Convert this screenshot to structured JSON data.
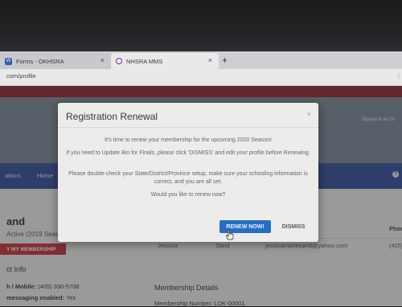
{
  "browser": {
    "tabs": [
      {
        "label": "Forms - OKHSRA",
        "close": "×"
      },
      {
        "label": "NHSRA MMS",
        "close": "×"
      }
    ],
    "new_tab": "+",
    "url": "com/profile"
  },
  "header": {
    "signed_in": "Signed in as Gr"
  },
  "nav": {
    "items": [
      "ations",
      "Horse"
    ]
  },
  "profile": {
    "name": "and",
    "status": "Active (2019 Seas",
    "membership_button": "Y MY MEMBERSHIP",
    "contact_title": "ct Info",
    "phone_label": "h / Mobile:",
    "phone_value": "(405) 330-5708",
    "messaging_label": "messaging enabled:",
    "messaging_value": "Yes"
  },
  "contacts_table": {
    "phone_header": "Phon",
    "row": {
      "first": "Jessica",
      "last": "Sand",
      "email": "jessicamariesand@yahoo.com",
      "phone": "(405)"
    }
  },
  "membership": {
    "title": "Membership Details",
    "number_label": "Membership Number:",
    "number_value": "LOK-00001"
  },
  "modal": {
    "title": "Registration Renewal",
    "close": "×",
    "line1": "It's time to renew your membership for the upcoming 2020 Season!",
    "line2": "If you need to Update Bio for Finals, please click 'DISMISS' and edit your profile before Renewing.",
    "line3": "Please double-check your State/District/Province setup, make sure your schooling information is correct, and you are all set.",
    "line4": "Would you like to renew now?",
    "renew_label": "RENEW NOW!",
    "dismiss_label": "DISMISS"
  },
  "colors": {
    "accent": "#1e6fd0",
    "nav": "#2f4d9a",
    "brand_red": "#8f2330",
    "button_red": "#c8303b"
  }
}
